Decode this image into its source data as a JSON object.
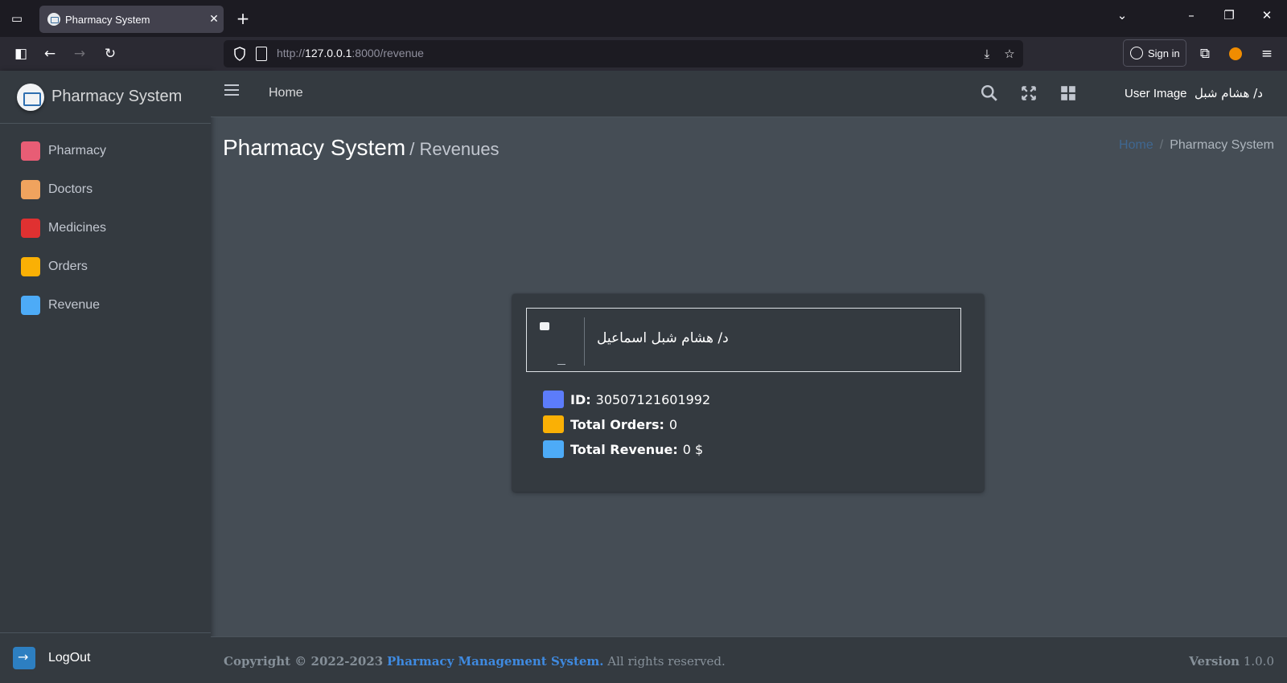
{
  "browser": {
    "tab_title": "Pharmacy System",
    "url_prefix": "http://",
    "url_host": "127.0.0.1",
    "url_path": ":8000/revenue",
    "sign_in": "Sign in"
  },
  "sidebar": {
    "brand": "Pharmacy System",
    "items": [
      {
        "label": "Pharmacy",
        "icon": "pharmacy-icon",
        "color": "#e85d75"
      },
      {
        "label": "Doctors",
        "icon": "doctors-icon",
        "color": "#f0a35e"
      },
      {
        "label": "Medicines",
        "icon": "medicines-icon",
        "color": "#e03131"
      },
      {
        "label": "Orders",
        "icon": "orders-icon",
        "color": "#fab005"
      },
      {
        "label": "Revenue",
        "icon": "revenue-icon",
        "color": "#4dabf7"
      }
    ],
    "logout": "LogOut"
  },
  "header": {
    "home": "Home",
    "user_image_alt": "User Image",
    "user_name": "د/ هشام شبل"
  },
  "content": {
    "title": "Pharmacy System",
    "subtitle": "/ Revenues",
    "breadcrumb": {
      "home": "Home",
      "separator": "/",
      "current": "Pharmacy System"
    }
  },
  "card": {
    "doctor_name": "د/ هشام شبل اسماعيل",
    "id_label": "ID:",
    "id_value": "30507121601992",
    "orders_label": "Total Orders:",
    "orders_value": "0",
    "revenue_label": "Total Revenue:",
    "revenue_value": "0 $"
  },
  "footer": {
    "copyright": "Copyright © 2022-2023",
    "brand": "Pharmacy Management System.",
    "rights": "All rights reserved.",
    "version_label": "Version",
    "version_value": "1.0.0"
  },
  "colors": {
    "sidebar_bg": "#343a40",
    "content_bg": "#454d55",
    "link": "#3f8ae0"
  }
}
